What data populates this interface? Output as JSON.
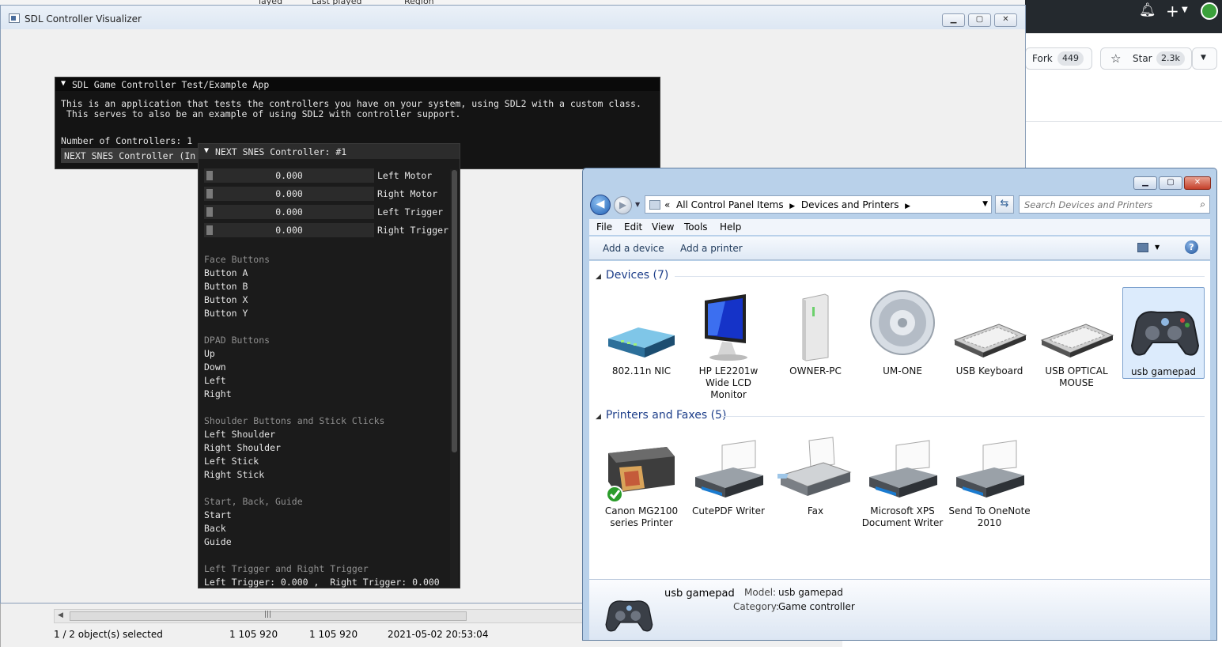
{
  "background": {
    "header_cells": [
      "layed",
      "Last played",
      "Region"
    ],
    "github": {
      "fork_label": "Fork",
      "fork_count": "449",
      "star_label": "Star",
      "star_count": "2.3k"
    },
    "file_manager_status": {
      "selection": "1 / 2 object(s) selected",
      "size1": "1 105 920",
      "size2": "1 105 920",
      "date": "2021-05-02 20:53:04"
    }
  },
  "sdl_window": {
    "title": "SDL Controller Visualizer",
    "main_panel": {
      "title": "SDL Game Controller Test/Example App",
      "desc_line1": "This is an application that tests the controllers you have on your system, using SDL2 with a custom class.",
      "desc_line2": " This serves to also be an example of using SDL2 with controller support.",
      "count_label": "Number of Controllers: 1",
      "controller_button": "NEXT SNES Controller (In"
    },
    "controller_panel": {
      "title": "NEXT SNES Controller: #1",
      "meters": [
        {
          "value": "0.000",
          "label": "Left Motor"
        },
        {
          "value": "0.000",
          "label": "Right Motor"
        },
        {
          "value": "0.000",
          "label": "Left Trigger"
        },
        {
          "value": "0.000",
          "label": "Right Trigger"
        }
      ],
      "sections": [
        {
          "heading": "Face Buttons",
          "items": [
            "Button A",
            "Button B",
            "Button X",
            "Button Y"
          ]
        },
        {
          "heading": "DPAD Buttons",
          "items": [
            "Up",
            "Down",
            "Left",
            "Right"
          ]
        },
        {
          "heading": "Shoulder Buttons and Stick Clicks",
          "items": [
            "Left Shoulder",
            "Right Shoulder",
            "Left Stick",
            "Right Stick"
          ]
        },
        {
          "heading": "Start, Back, Guide",
          "items": [
            "Start",
            "Back",
            "Guide"
          ]
        },
        {
          "heading": "Left Trigger and Right Trigger",
          "items": [
            "Left Trigger: 0.000 ,  Right Trigger: 0.000"
          ]
        }
      ]
    }
  },
  "devices_window": {
    "address": {
      "prefix": "«",
      "crumb1": "All Control Panel Items",
      "crumb2": "Devices and Printers"
    },
    "search_placeholder": "Search Devices and Printers",
    "menu": [
      "File",
      "Edit",
      "View",
      "Tools",
      "Help"
    ],
    "commands": {
      "add_device": "Add a device",
      "add_printer": "Add a printer"
    },
    "devices_group": "Devices (7)",
    "devices": [
      {
        "label": "802.11n NIC",
        "icon": "router-icon"
      },
      {
        "label": "HP LE2201w Wide LCD Monitor",
        "icon": "monitor-icon"
      },
      {
        "label": "OWNER-PC",
        "icon": "computer-tower-icon"
      },
      {
        "label": "UM-ONE",
        "icon": "speaker-icon"
      },
      {
        "label": "USB Keyboard",
        "icon": "keyboard-icon"
      },
      {
        "label": "USB OPTICAL MOUSE",
        "icon": "keyboard-icon"
      },
      {
        "label": "usb gamepad",
        "icon": "gamepad-icon"
      }
    ],
    "printers_group": "Printers and Faxes (5)",
    "printers": [
      {
        "label": "Canon MG2100 series Printer",
        "icon": "multifunction-printer-icon"
      },
      {
        "label": "CutePDF Writer",
        "icon": "printer-icon"
      },
      {
        "label": "Fax",
        "icon": "fax-icon"
      },
      {
        "label": "Microsoft XPS Document Writer",
        "icon": "printer-icon"
      },
      {
        "label": "Send To OneNote 2010",
        "icon": "printer-icon"
      }
    ],
    "details": {
      "name": "usb gamepad",
      "model_key": "Model:",
      "model_val": "usb gamepad",
      "category_key": "Category:",
      "category_val": "Game controller"
    }
  }
}
